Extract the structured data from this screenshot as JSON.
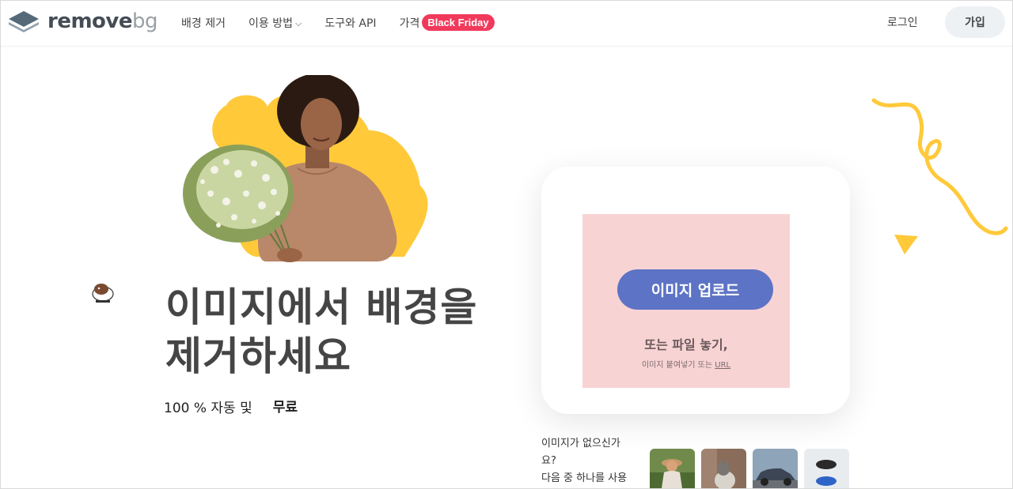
{
  "header": {
    "logo_main": "remove",
    "logo_suffix": "bg",
    "nav": [
      {
        "label": "배경 제거"
      },
      {
        "label": "이용 방법",
        "has_dropdown": true
      },
      {
        "label": "도구와 API"
      },
      {
        "label": "가격",
        "badge": "Black Friday"
      }
    ],
    "login": "로그인",
    "signup": "가입"
  },
  "hero": {
    "headline_line1": "이미지에서 배경을",
    "headline_line2": "제거하세요",
    "sub_prefix": "100 % 자동 및",
    "sub_highlight": "무료"
  },
  "upload": {
    "button": "이미지 업로드",
    "drop_text": "또는 파일 놓기,",
    "hint_prefix": "이미지 붙여넣기 또는",
    "hint_link": "URL"
  },
  "samples": {
    "label_line1": "이미지가 없으신가",
    "label_line2": "요?",
    "label_line3": "다음 중 하나를 사용"
  },
  "colors": {
    "accent": "#5d73c5",
    "badge": "#f1395b",
    "yellow": "#ffc93a",
    "drop_bg": "#f8d3d4"
  }
}
